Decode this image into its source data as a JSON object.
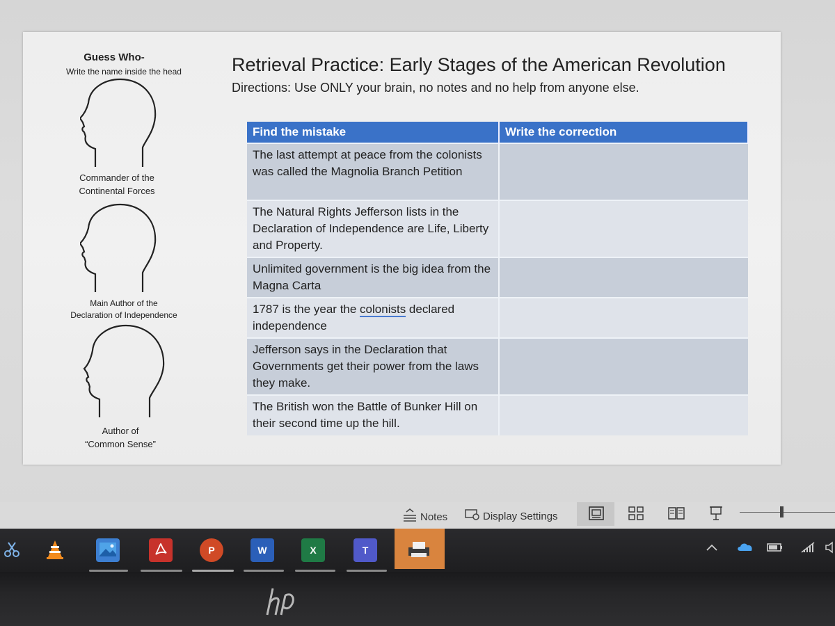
{
  "slide": {
    "guess_title": "Guess Who-",
    "guess_subtitle": "Write the name inside the head",
    "heads": [
      {
        "label_line1": "Commander of the",
        "label_line2": "Continental Forces"
      },
      {
        "label_line1": "Main Author of the",
        "label_line2": "Declaration of Independence"
      },
      {
        "label_line1": "Author of",
        "label_line2": "“Common Sense”"
      }
    ],
    "title": "Retrieval Practice: Early Stages of the American Revolution",
    "directions": "Directions: Use ONLY your brain, no notes and no help from anyone else.",
    "table": {
      "headers": [
        "Find the mistake",
        "Write the correction"
      ],
      "rows": [
        {
          "mistake": "The last attempt at peace from the colonists was called the Magnolia Branch Petition",
          "correction": ""
        },
        {
          "mistake": "The Natural Rights Jefferson lists in the Declaration of Independence are Life, Liberty and Property.",
          "correction": ""
        },
        {
          "mistake": "Unlimited government is the big idea from the Magna Carta",
          "correction": ""
        },
        {
          "mistake_before": "1787 is the year the ",
          "mistake_flagged": "colonists",
          "mistake_after": " declared independence",
          "correction": ""
        },
        {
          "mistake": "Jefferson says in the Declaration that Governments get their power from the laws they make.",
          "correction": ""
        },
        {
          "mistake": "The British won the Battle of Bunker Hill on their second time up the hill.",
          "correction": ""
        }
      ]
    }
  },
  "statusbar": {
    "notes_label": "Notes",
    "display_settings_label": "Display Settings",
    "icons": [
      "notes-icon",
      "display-settings-icon",
      "normal-view-icon",
      "slide-sorter-icon",
      "reading-view-icon",
      "slideshow-icon"
    ]
  },
  "taskbar": {
    "apps": [
      {
        "name": "snipping-tool",
        "icon": "scissors-icon"
      },
      {
        "name": "vlc",
        "icon": "vlc-cone-icon"
      },
      {
        "name": "photos",
        "icon": "photos-icon"
      },
      {
        "name": "acrobat",
        "icon": "acrobat-icon"
      },
      {
        "name": "powerpoint",
        "letter": "P"
      },
      {
        "name": "word",
        "letter": "W"
      },
      {
        "name": "excel",
        "letter": "X"
      },
      {
        "name": "teams",
        "letter": "T"
      },
      {
        "name": "printer",
        "icon": "printer-icon"
      }
    ],
    "tray_icons": [
      "chevron-up-icon",
      "onedrive-icon",
      "battery-icon",
      "wifi-icon",
      "volume-icon"
    ]
  },
  "bezel": {
    "brand": "hp"
  },
  "colors": {
    "table_header": "#3a72c8",
    "row_dark": "#c7ced9",
    "row_light": "#dfe3ea",
    "active_app": "#d9843e"
  }
}
